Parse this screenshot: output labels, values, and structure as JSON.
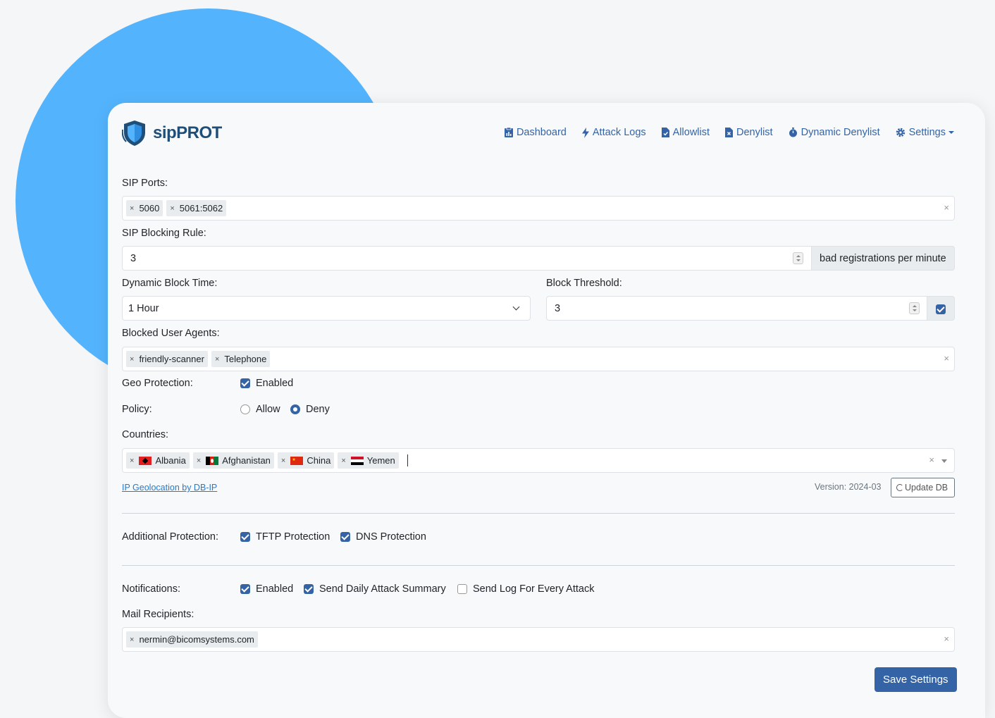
{
  "brand": {
    "name": "sipPROT"
  },
  "nav": {
    "dashboard": "Dashboard",
    "attack_logs": "Attack Logs",
    "allowlist": "Allowlist",
    "denylist": "Denylist",
    "dynamic_denylist": "Dynamic Denylist",
    "settings": "Settings"
  },
  "form": {
    "sip_ports_label": "SIP Ports:",
    "sip_ports": [
      "5060",
      "5061:5062"
    ],
    "sip_blocking_rule_label": "SIP Blocking Rule:",
    "sip_blocking_rule_value": "3",
    "sip_blocking_rule_suffix": "bad registrations per minute",
    "dynamic_block_time_label": "Dynamic Block Time:",
    "dynamic_block_time_value": "1 Hour",
    "block_threshold_label": "Block Threshold:",
    "block_threshold_value": "3",
    "blocked_user_agents_label": "Blocked User Agents:",
    "blocked_user_agents": [
      "friendly-scanner",
      "Telephone"
    ],
    "geo_protection_label": "Geo Protection:",
    "geo_enabled_label": "Enabled",
    "policy_label": "Policy:",
    "policy_allow": "Allow",
    "policy_deny": "Deny",
    "countries_label": "Countries:",
    "countries": [
      "Albania",
      "Afghanistan",
      "China",
      "Yemen"
    ],
    "geo_link": "IP Geolocation by DB-IP",
    "version_text": "Version: 2024-03",
    "update_db": "Update DB",
    "additional_protection_label": "Additional Protection:",
    "tftp_protection": "TFTP Protection",
    "dns_protection": "DNS Protection",
    "notifications_label": "Notifications:",
    "notif_enabled": "Enabled",
    "notif_daily_summary": "Send Daily Attack Summary",
    "notif_every_attack": "Send Log For Every Attack",
    "mail_recipients_label": "Mail Recipients:",
    "mail_recipients": [
      "nermin@bicomsystems.com"
    ],
    "save_button": "Save Settings",
    "tag_remove": "×",
    "clear_all": "×"
  },
  "colors": {
    "accent": "#3464a6",
    "brand": "#1f4e79",
    "circle": "#53b4fd"
  }
}
